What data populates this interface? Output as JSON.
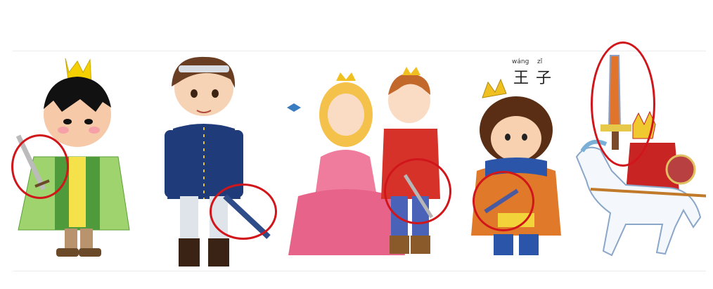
{
  "caption": {
    "chars": [
      "王",
      "子"
    ],
    "pinyin": [
      "wáng",
      "zǐ"
    ]
  },
  "colors": {
    "highlight_circle": "#d0161a",
    "background": "#ffffff"
  },
  "figures": [
    {
      "icon": "cartoon-prince-crown-green-cape-icon",
      "holds": "sword"
    },
    {
      "icon": "cartoon-prince-blue-uniform-icon",
      "holds": "sword"
    },
    {
      "icon": "cartoon-princess-and-prince-icon",
      "holds": "sword"
    },
    {
      "icon": "cartoon-boy-prince-icon",
      "holds": "sword"
    },
    {
      "icon": "cartoon-knight-on-horse-icon",
      "holds": "sword"
    }
  ]
}
